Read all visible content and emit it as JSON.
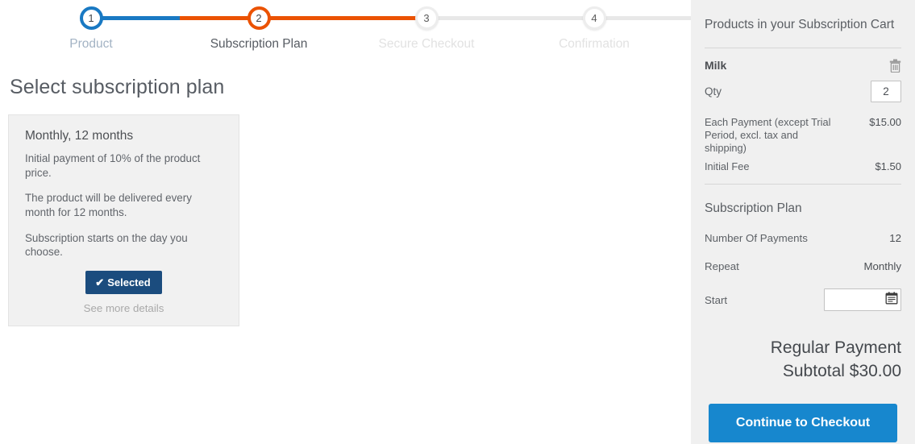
{
  "stepper": {
    "steps": [
      {
        "number": "1",
        "label": "Product",
        "state": "complete"
      },
      {
        "number": "2",
        "label": "Subscription Plan",
        "state": "active"
      },
      {
        "number": "3",
        "label": "Secure Checkout",
        "state": "upcoming"
      },
      {
        "number": "4",
        "label": "Confirmation",
        "state": "upcoming"
      }
    ],
    "colors": {
      "complete": "#1979c3",
      "active": "#eb5202",
      "upcoming": "#e8e8e8"
    }
  },
  "main": {
    "title": "Select subscription plan",
    "plan": {
      "name": "Monthly, 12 months",
      "line1": "Initial payment of 10% of the product price.",
      "line2": "The product will be delivered every month for 12 months.",
      "line3": "Subscription starts on the day you choose.",
      "selected_label": "Selected",
      "selected_check": "✔",
      "see_more_label": "See more details",
      "selected_color": "#1b4c7e"
    }
  },
  "sidebar": {
    "cart_heading": "Products in your Subscription Cart",
    "product": {
      "name": "Milk",
      "remove_icon": "trash-icon",
      "qty_label": "Qty",
      "qty_value": "2"
    },
    "fees": [
      {
        "label": "Each Payment (except Trial Period, excl. tax and shipping)",
        "value": "$15.00"
      },
      {
        "label": "Initial Fee",
        "value": "$1.50"
      }
    ],
    "plan_heading": "Subscription Plan",
    "details": [
      {
        "key": "Number Of Payments",
        "value": "12"
      },
      {
        "key": "Repeat",
        "value": "Monthly"
      }
    ],
    "start": {
      "label": "Start",
      "value": "",
      "placeholder": "",
      "icon": "calendar-icon"
    },
    "totals": {
      "line1": "Regular Payment",
      "line2": "Subtotal $30.00"
    },
    "checkout_label": "Continue to Checkout",
    "checkout_color": "#1787ce"
  }
}
